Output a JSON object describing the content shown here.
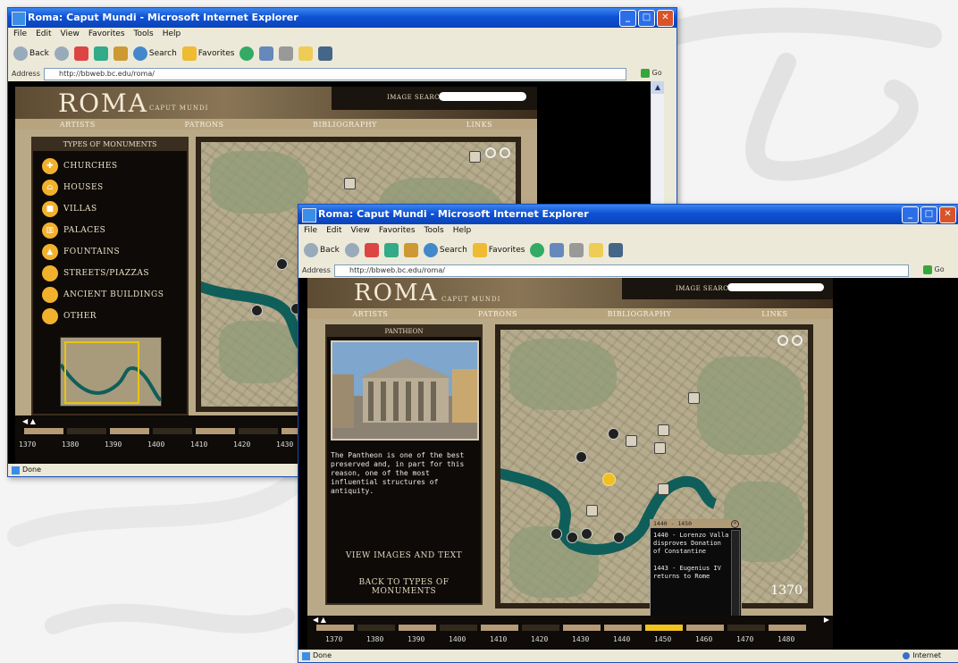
{
  "browser": {
    "window_title": "Roma: Caput Mundi - Microsoft Internet Explorer",
    "menu": [
      "File",
      "Edit",
      "View",
      "Favorites",
      "Tools",
      "Help"
    ],
    "toolbar": {
      "back": "Back",
      "search": "Search",
      "favorites": "Favorites"
    },
    "address_label": "Address",
    "address_url": "http://bbweb.bc.edu/roma/",
    "go_label": "Go",
    "status_text": "Done",
    "zone_text": "Internet"
  },
  "site": {
    "logo": "ROMA",
    "logo_sub": "CAPUT MUNDI",
    "image_search_label": "IMAGE SEARCH:",
    "nav": [
      "ARTISTS",
      "PATRONS",
      "BIBLIOGRAPHY",
      "LINKS"
    ]
  },
  "window1": {
    "panel_title": "TYPES OF MONUMENTS",
    "monument_types": [
      {
        "label": "CHURCHES",
        "icon": "cross-icon"
      },
      {
        "label": "HOUSES",
        "icon": "house-icon"
      },
      {
        "label": "VILLAS",
        "icon": "villa-icon"
      },
      {
        "label": "PALACES",
        "icon": "palace-icon"
      },
      {
        "label": "FOUNTAINS",
        "icon": "fountain-icon"
      },
      {
        "label": "STREETS/PIAZZAS",
        "icon": "street-icon"
      },
      {
        "label": "ANCIENT BUILDINGS",
        "icon": "column-icon"
      },
      {
        "label": "OTHER",
        "icon": "dot-icon"
      }
    ],
    "timeline_years": [
      "1370",
      "1380",
      "1390",
      "1400",
      "1410",
      "1420",
      "1430"
    ]
  },
  "window2": {
    "panel_title": "PANTHEON",
    "description": "The Pantheon is one of the best preserved and, in part for this reason, one of the most influential structures of antiquity.",
    "view_images_link": "VIEW IMAGES AND TEXT",
    "back_link": "BACK TO TYPES OF MONUMENTS",
    "year_badge": "1370",
    "popup": {
      "title": "1440 - 1450",
      "entries": [
        "1440 - Lorenzo Valla disproves Donation of Constantine",
        "1443 - Eugenius IV returns to Rome"
      ]
    },
    "timeline_years": [
      "1370",
      "1380",
      "1390",
      "1400",
      "1410",
      "1420",
      "1430",
      "1440",
      "1450",
      "1460",
      "1470",
      "1480"
    ]
  },
  "colors": {
    "accent": "#f2b12c",
    "timeline_highlight": "#f2c21f",
    "river": "#0f5e5a",
    "xp_title": "#0f52d4"
  }
}
